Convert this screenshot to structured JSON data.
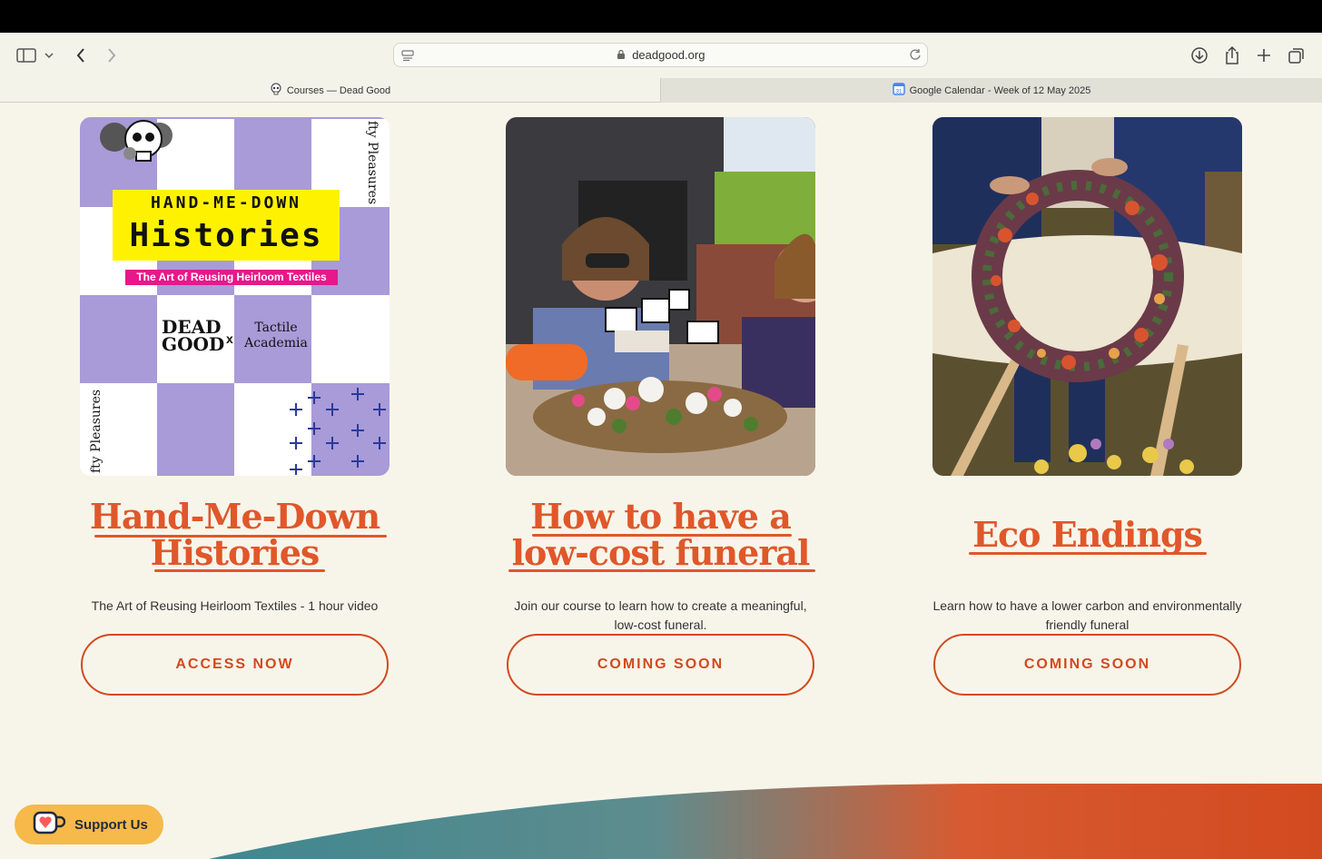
{
  "browser": {
    "url": "deadgood.org",
    "tabs": [
      {
        "title": "Courses — Dead Good",
        "active": true
      },
      {
        "title": "Google Calendar - Week of 12 May 2025",
        "active": false
      }
    ]
  },
  "cards": [
    {
      "image_texts": {
        "line1": "HAND-ME-DOWN",
        "line2": "Histories",
        "subtitle": "The Art of Reusing Heirloom Textiles",
        "logo1a": "DEAD",
        "logo1b": "GOOD",
        "cross": "x",
        "logo2a": "Tactile",
        "logo2b": "Academia",
        "side_top": "fty Pleasures",
        "side_bottom": "fty Pleasures"
      },
      "title_line1": "Hand-Me-Down",
      "title_line2": "Histories",
      "description": "The Art of Reusing Heirloom Textiles - 1 hour video",
      "button": "ACCESS NOW"
    },
    {
      "title_line1": "How to have a",
      "title_line2": "low-cost funeral",
      "description": "Join our course to learn how to create a meaningful, low-cost funeral.",
      "button": "COMING SOON"
    },
    {
      "title_line1": "Eco Endings",
      "description": "Learn how to have a lower carbon and environmentally friendly funeral",
      "button": "COMING SOON"
    }
  ],
  "support": {
    "label": "Support Us"
  },
  "colors": {
    "accent": "#e0572a",
    "background": "#f7f5ea",
    "support": "#f6b94a"
  }
}
